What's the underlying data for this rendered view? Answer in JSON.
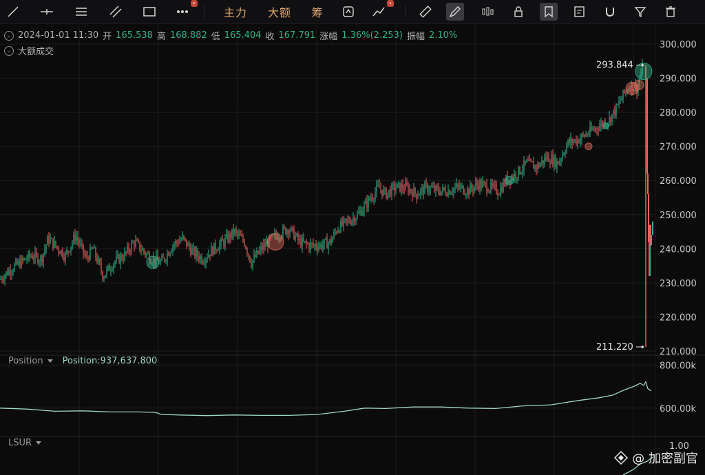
{
  "toolbar": {
    "tools": [
      {
        "id": "trend-line",
        "icon": "trend-line-icon"
      },
      {
        "id": "horizontal-line",
        "icon": "horizontal-line-icon"
      },
      {
        "id": "parallel-lines",
        "icon": "parallel-lines-icon"
      },
      {
        "id": "parallel-channel",
        "icon": "parallel-channel-icon"
      },
      {
        "id": "rectangle",
        "icon": "rectangle-icon"
      },
      {
        "id": "more",
        "icon": "more-icon"
      }
    ],
    "text_tools": [
      "主力",
      "大额",
      "筹"
    ],
    "right_tools": [
      {
        "id": "ruler",
        "icon": "ruler-icon"
      },
      {
        "id": "pen",
        "icon": "pen-icon"
      },
      {
        "id": "candles",
        "icon": "candles-icon"
      },
      {
        "id": "lock",
        "icon": "lock-icon"
      },
      {
        "id": "bookmark",
        "icon": "bookmark-icon"
      },
      {
        "id": "note",
        "icon": "note-icon"
      },
      {
        "id": "magnet",
        "icon": "magnet-icon"
      },
      {
        "id": "filter",
        "icon": "filter-icon"
      },
      {
        "id": "trash",
        "icon": "trash-icon"
      }
    ]
  },
  "info_bar": {
    "datetime": "2024-01-01 11:30",
    "open_label": "开",
    "open": "165.538",
    "high_label": "高",
    "high": "168.882",
    "low_label": "低",
    "low": "165.404",
    "close_label": "收",
    "close": "167.791",
    "change_label": "涨幅",
    "change": "1.36%(2.253)",
    "amplitude_label": "振幅",
    "amplitude": "2.10%"
  },
  "indicator_label": "大额成交",
  "position_pane": {
    "label": "Position",
    "value_label": "Position:937,637.800"
  },
  "lsur_pane": {
    "label": "LSUR",
    "axis_top": "1.00"
  },
  "watermark": "@ 加密副官",
  "colors": {
    "up": "#2fb38b",
    "down": "#e2665a",
    "position_line": "#9ed6c4",
    "grid": "#1e1e22",
    "text": "#c8c8c8"
  },
  "chart_data": [
    {
      "type": "line",
      "title": "",
      "x": [
        0,
        15,
        30,
        45,
        60,
        70,
        80,
        95,
        110,
        125,
        135,
        150,
        165,
        180,
        195,
        205,
        220,
        235,
        250,
        265,
        280,
        295,
        310,
        325,
        340,
        355,
        365,
        380,
        395,
        410,
        420,
        435,
        450,
        465,
        480,
        490,
        505,
        520,
        535,
        550,
        560,
        575,
        590,
        605,
        620,
        635,
        650,
        665,
        680,
        695,
        710,
        725,
        735,
        750,
        765,
        780,
        795,
        810,
        825,
        840,
        855,
        870,
        885,
        895,
        905,
        915,
        925,
        932,
        936,
        938,
        940,
        941,
        942,
        943,
        944,
        945,
        946,
        948
      ],
      "series": [
        {
          "values": [
            231,
            234,
            236,
            238,
            237,
            243,
            241,
            238,
            244,
            237,
            240,
            232,
            236,
            238,
            242,
            240,
            237,
            236,
            241,
            243,
            239,
            237,
            240,
            242,
            245,
            242,
            236,
            240,
            243,
            245,
            246,
            242,
            241,
            241,
            242,
            246,
            248,
            250,
            254,
            258,
            256,
            258,
            258,
            256,
            258,
            257,
            257,
            258,
            257,
            259,
            258,
            257,
            260,
            262,
            265,
            264,
            267,
            265,
            271,
            272,
            274,
            276,
            278,
            281,
            285,
            288,
            287,
            292,
            293.844,
            290,
            262,
            256,
            242,
            232,
            247,
            241,
            244,
            248
          ]
        }
      ],
      "y_axis_ticks": [
        "300.000",
        "290.000",
        "280.000",
        "270.000",
        "260.000",
        "250.000",
        "240.000",
        "230.000",
        "220.000",
        "210.000"
      ],
      "ylim": [
        210,
        300
      ],
      "annotations": [
        {
          "label": "293.844",
          "x": 936,
          "y": 293.844
        },
        {
          "label": "211.220",
          "x": 938,
          "y": 211.22
        }
      ],
      "grid": true
    },
    {
      "type": "line",
      "title": "",
      "x": [
        0,
        40,
        80,
        120,
        160,
        200,
        225,
        235,
        260,
        300,
        340,
        380,
        420,
        460,
        500,
        530,
        560,
        600,
        640,
        680,
        720,
        760,
        800,
        840,
        870,
        890,
        905,
        920,
        930,
        935,
        938,
        941,
        946
      ],
      "series": [
        {
          "name": "Position",
          "values": [
            600,
            595,
            585,
            587,
            582,
            582,
            580,
            570,
            568,
            565,
            568,
            566,
            566,
            570,
            585,
            600,
            598,
            605,
            605,
            600,
            598,
            610,
            615,
            635,
            648,
            660,
            682,
            700,
            715,
            705,
            722,
            690,
            680
          ]
        }
      ],
      "y_axis_ticks": [
        "800.00k",
        "600.00k"
      ],
      "ylim": [
        500,
        820
      ],
      "grid": true
    }
  ]
}
